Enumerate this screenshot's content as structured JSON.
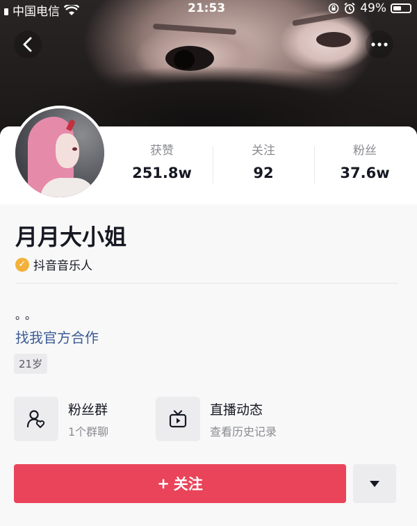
{
  "status_bar": {
    "carrier": "中国电信",
    "time": "21:53",
    "battery": "49%",
    "battery_level": 0.49
  },
  "nav": {
    "back_icon": "chevron-left-icon",
    "more_icon": "ellipsis-icon"
  },
  "profile": {
    "stats": [
      {
        "label": "获赞",
        "value": "251.8w"
      },
      {
        "label": "关注",
        "value": "92"
      },
      {
        "label": "粉丝",
        "value": "37.6w"
      }
    ],
    "name": "月月大小姐",
    "verification": "抖音音乐人",
    "bio": "。。",
    "link": "找我官方合作",
    "age_tag": "21岁"
  },
  "features": [
    {
      "title": "粉丝群",
      "subtitle": "1个群聊",
      "icon": "fan-group-icon"
    },
    {
      "title": "直播动态",
      "subtitle": "查看历史记录",
      "icon": "live-tv-icon"
    }
  ],
  "actions": {
    "follow_plus": "+",
    "follow_label": "关注",
    "dropdown_icon": "triangle-down-icon"
  },
  "colors": {
    "follow_button": "#ea445a",
    "link": "#3b5b95",
    "verify_badge": "#f2b13a"
  }
}
